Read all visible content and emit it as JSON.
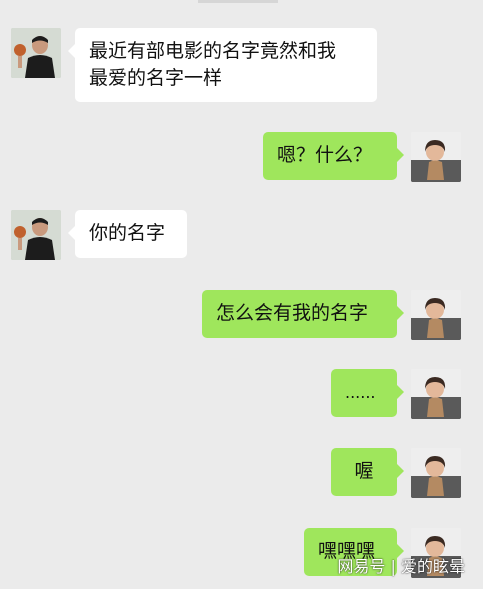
{
  "colors": {
    "background": "#ebebeb",
    "sent_bubble": "#9fe65c",
    "received_bubble": "#ffffff"
  },
  "messages": [
    {
      "side": "left",
      "avatar": "boy-avatar",
      "lines": [
        "最近有部电影的名字竟然和我",
        "最爱的名字一样"
      ]
    },
    {
      "side": "right",
      "avatar": "girl-avatar",
      "lines": [
        "嗯？什么？"
      ]
    },
    {
      "side": "left",
      "avatar": "boy-avatar",
      "lines": [
        "你的名字"
      ]
    },
    {
      "side": "right",
      "avatar": "girl-avatar",
      "lines": [
        "怎么会有我的名字"
      ]
    },
    {
      "side": "right",
      "avatar": "girl-avatar",
      "lines": [
        "......"
      ]
    },
    {
      "side": "right",
      "avatar": "girl-avatar",
      "lines": [
        "喔"
      ]
    },
    {
      "side": "right",
      "avatar": "girl-avatar",
      "lines": [
        "嘿嘿嘿"
      ]
    }
  ],
  "watermark": {
    "text": "网易号 | 爱的眩晕"
  }
}
